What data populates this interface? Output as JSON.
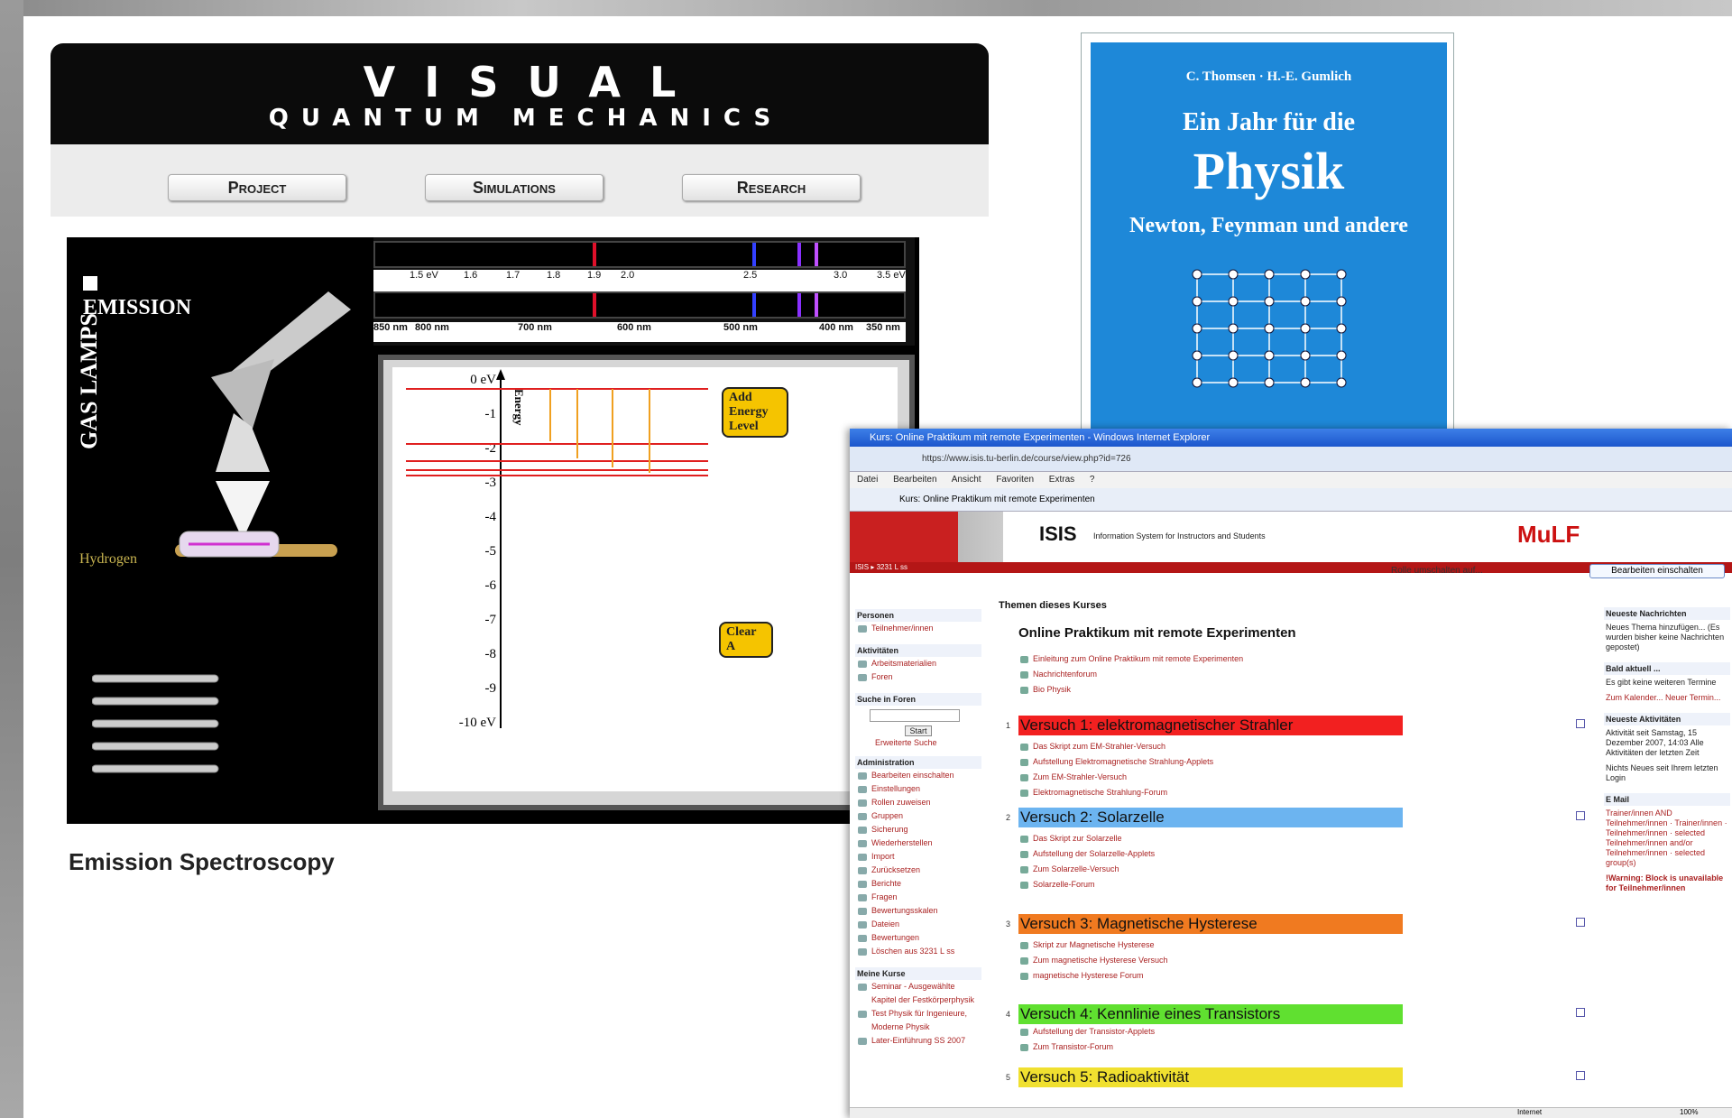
{
  "vqm": {
    "title_line1": "VISUAL",
    "title_line2": "QUANTUM MECHANICS",
    "nav": [
      "Project",
      "Simulations",
      "Research"
    ],
    "emission_label": "EMISSION",
    "gas_lamps_label": "GAS LAMPS",
    "hydrogen_label": "Hydrogen",
    "ev_scale": [
      "1.5 eV",
      "1.6",
      "1.7",
      "1.8",
      "1.9",
      "2.0",
      "2.5",
      "3.0",
      "3.5 eV"
    ],
    "nm_scale": [
      "850 nm",
      "800 nm",
      "700 nm",
      "600 nm",
      "500 nm",
      "400 nm",
      "350 nm"
    ],
    "energy_axis_label": "Energy",
    "energy_levels": [
      "0 eV",
      "-1",
      "-2",
      "-3",
      "-4",
      "-5",
      "-6",
      "-7",
      "-8",
      "-9",
      "-10 eV"
    ],
    "add_energy_btn": "Add Energy Level",
    "clear_btn": "Clear A",
    "caption": "Emission Spectroscopy",
    "line_colors": {
      "red": "#e0102a",
      "blue": "#3340ff",
      "violet": "#8a30ff",
      "purple": "#c050ff"
    }
  },
  "book": {
    "authors": "C. Thomsen · H.-E. Gumlich",
    "title_line1": "Ein Jahr für die",
    "title_line2": "Physik",
    "subtitle": "Newton, Feynman und andere",
    "cover_color": "#1e88d8"
  },
  "ie": {
    "window_title": "Kurs: Online Praktikum mit remote Experimenten - Windows Internet Explorer",
    "address": "https://www.isis.tu-berlin.de/course/view.php?id=726",
    "menu": [
      "Datei",
      "Bearbeiten",
      "Ansicht",
      "Favoriten",
      "Extras",
      "?"
    ],
    "tab_label": "Kurs: Online Praktikum mit remote Experimenten",
    "isis_logo": "ISIS",
    "isis_sub": "Information System for Instructors and Students",
    "mulf_logo": "MuLF",
    "breadcrumb": "ISIS ▸ 3231 L ss",
    "role_label": "Rolle umschalten auf...",
    "edit_button": "Bearbeiten einschalten",
    "left_blocks": [
      {
        "title": "Personen",
        "items": [
          "Teilnehmer/innen"
        ]
      },
      {
        "title": "Aktivitäten",
        "items": [
          "Arbeitsmaterialien",
          "Foren"
        ]
      },
      {
        "title": "Suche in Foren",
        "items": [
          "Start",
          "Erweiterte Suche"
        ]
      },
      {
        "title": "Administration",
        "items": [
          "Bearbeiten einschalten",
          "Einstellungen",
          "Rollen zuweisen",
          "Gruppen",
          "Sicherung",
          "Wiederherstellen",
          "Import",
          "Zurücksetzen",
          "Berichte",
          "Fragen",
          "Bewertungsskalen",
          "Dateien",
          "Bewertungen",
          "Löschen aus 3231 L ss"
        ]
      },
      {
        "title": "Meine Kurse",
        "items": [
          "Seminar - Ausgewählte Kapitel der Festkörperphysik",
          "Test Physik für Ingenieure, Moderne Physik",
          "Later-Einführung SS 2007"
        ]
      }
    ],
    "main_heading": "Themen dieses Kurses",
    "course_title": "Online Praktikum mit remote Experimenten",
    "intro_links": [
      "Einleitung zum Online Praktikum mit remote Experimenten",
      "Nachrichtenforum",
      "Bio Physik"
    ],
    "sections": [
      {
        "num": "1",
        "title": "Versuch 1: elektromagnetischer Strahler",
        "color": "#f22020",
        "links": [
          "Das Skript zum EM-Strahler-Versuch",
          "Aufstellung Elektromagnetische Strahlung-Applets",
          "Zum EM-Strahler-Versuch",
          "Elektromagnetische Strahlung-Forum"
        ]
      },
      {
        "num": "2",
        "title": "Versuch 2: Solarzelle",
        "color": "#6cb4f0",
        "links": [
          "Das Skript zur Solarzelle",
          "Aufstellung der Solarzelle-Applets",
          "Zum Solarzelle-Versuch",
          "Solarzelle-Forum"
        ]
      },
      {
        "num": "3",
        "title": "Versuch 3: Magnetische Hysterese",
        "color": "#f07a20",
        "links": [
          "Skript zur Magnetische Hysterese",
          "Zum magnetische Hysterese Versuch",
          "magnetische Hysterese Forum"
        ]
      },
      {
        "num": "4",
        "title": "Versuch 4: Kennlinie eines Transistors",
        "color": "#60e030",
        "links": [
          "Aufstellung der Transistor-Applets",
          "Zum Transistor-Forum"
        ]
      },
      {
        "num": "5",
        "title": "Versuch 5: Radioaktivität",
        "color": "#f0e030",
        "links": []
      }
    ],
    "right_blocks": [
      {
        "title": "Neueste Nachrichten",
        "text": "Neues Thema hinzufügen... (Es wurden bisher keine Nachrichten gepostet)"
      },
      {
        "title": "Bald aktuell ...",
        "text": "Es gibt keine weiteren Termine"
      },
      {
        "title": "",
        "text": "Zum Kalender... Neuer Termin..."
      },
      {
        "title": "Neueste Aktivitäten",
        "text": "Aktivität seit Samstag, 15 Dezember 2007, 14:03 Alle Aktivitäten der letzten Zeit"
      },
      {
        "title": "",
        "text": "Nichts Neues seit Ihrem letzten Login"
      },
      {
        "title": "E Mail",
        "text": "Trainer/innen AND Teilnehmer/innen · Trainer/innen · Teilnehmer/innen · selected Teilnehmer/innen and/or Teilnehmer/innen · selected group(s)"
      },
      {
        "title": "",
        "text": "!Warning: Block is unavailable for Teilnehmer/innen"
      }
    ],
    "status_left": "Internet",
    "status_zoom": "100%"
  }
}
